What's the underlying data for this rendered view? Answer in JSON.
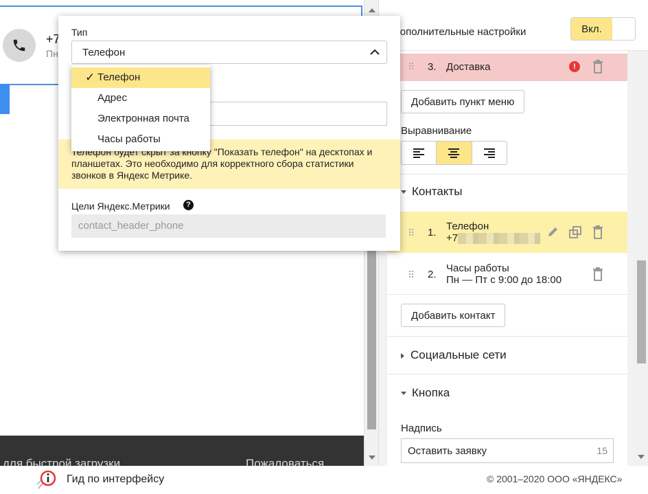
{
  "preview": {
    "phone_number": "+7",
    "phone_sub": "Пн",
    "footer_left": "для быстрой загрузки",
    "footer_right": "Пожаловаться"
  },
  "panel": {
    "header_title": "дополнительные настройки",
    "toggle_label": "Вкл.",
    "menu_item": {
      "number": "3.",
      "label": "Доставка"
    },
    "add_menu_item_label": "Добавить пункт меню",
    "alignment_label": "Выравнивание",
    "alignment_selected": "center",
    "contacts_title": "Контакты",
    "contacts": [
      {
        "number": "1.",
        "title": "Телефон",
        "value": "+7"
      },
      {
        "number": "2.",
        "title": "Часы работы",
        "value": "Пн — Пт с 9:00 до 18:00"
      }
    ],
    "add_contact_label": "Добавить контакт",
    "social_title": "Социальные сети",
    "button_title": "Кнопка",
    "caption_label": "Надпись",
    "caption_value": "Оставить заявку",
    "caption_counter": "15"
  },
  "popup": {
    "type_label": "Тип",
    "type_value": "Телефон",
    "options": [
      "Телефон",
      "Адрес",
      "Электронная почта",
      "Часы работы"
    ],
    "selected_index": 0,
    "note": "Телефон будет скрыт за кнопку \"Показать телефон\" на десктопах и планшетах. Это необходимо для корректного сбора статистики звонков в Яндекс Метрике.",
    "metrika_label": "Цели Яндекс.Метрики",
    "metrika_value": "contact_header_phone"
  },
  "bottom": {
    "guide_label": "Гид по интерфейсу",
    "copyright": "© 2001–2020 ООО «ЯНДЕКС»"
  },
  "colors": {
    "accent_yellow": "#fde68a",
    "error_row": "#f6c9c9",
    "error_icon": "#e53935",
    "preview_blue": "#3d8ef0"
  }
}
